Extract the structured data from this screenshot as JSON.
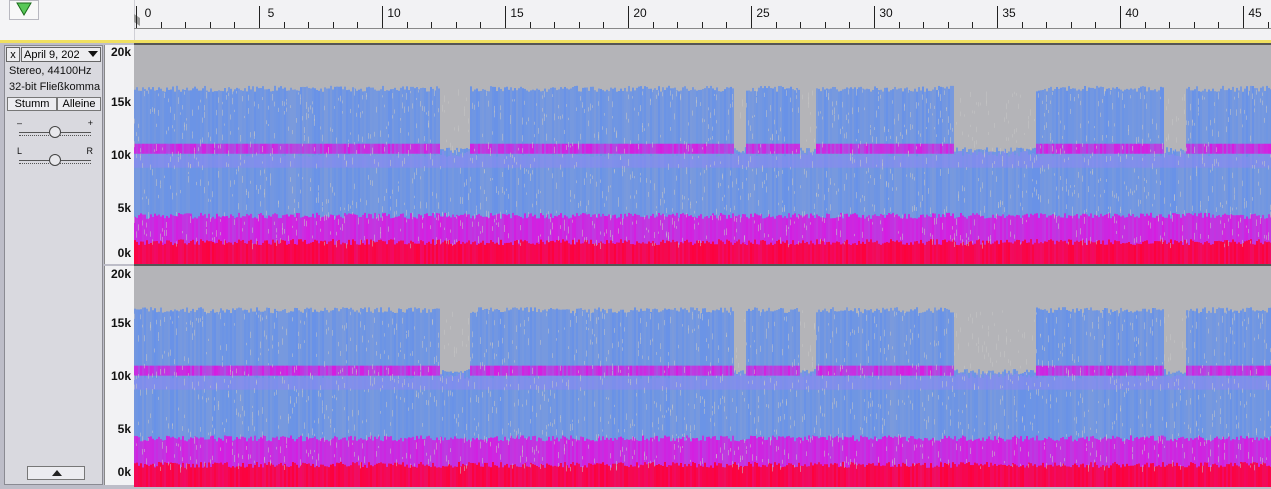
{
  "ruler": {
    "ticks": [
      "0",
      "5",
      "10",
      "15",
      "20",
      "25",
      "30",
      "35",
      "40",
      "45"
    ]
  },
  "track": {
    "name": "April 9, 202",
    "format": "Stereo, 44100Hz",
    "sample_format": "32-bit Fließkomma",
    "mute_label": "Stumm",
    "solo_label": "Alleine",
    "gain_minus": "–",
    "gain_plus": "+",
    "pan_left": "L",
    "pan_right": "R",
    "close_glyph": "x"
  },
  "spectrogram": {
    "freq_labels": [
      "20k",
      "15k",
      "10k",
      "5k",
      "0k"
    ]
  },
  "icons": {
    "play_head": "triangle-down-icon",
    "collapse": "triangle-up-icon"
  },
  "colors": {
    "background": "#bdbdc8",
    "spectrogram_bg": "#b4b4b8",
    "spectrum_low": "#ff0033",
    "spectrum_mid": "#e010e0",
    "spectrum_high": "#5a8cf0"
  }
}
